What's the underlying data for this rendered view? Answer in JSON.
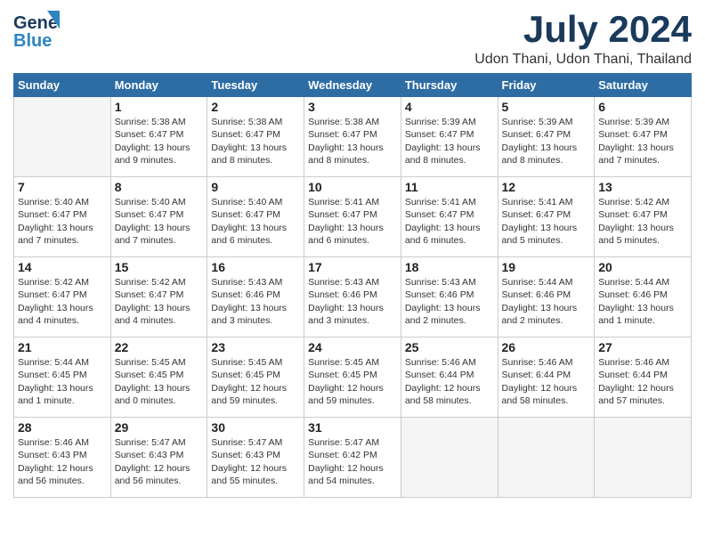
{
  "header": {
    "logo_line1": "General",
    "logo_line2": "Blue",
    "month_title": "July 2024",
    "location": "Udon Thani, Udon Thani, Thailand"
  },
  "days_of_week": [
    "Sunday",
    "Monday",
    "Tuesday",
    "Wednesday",
    "Thursday",
    "Friday",
    "Saturday"
  ],
  "weeks": [
    [
      {
        "day": "",
        "info": ""
      },
      {
        "day": "1",
        "info": "Sunrise: 5:38 AM\nSunset: 6:47 PM\nDaylight: 13 hours\nand 9 minutes."
      },
      {
        "day": "2",
        "info": "Sunrise: 5:38 AM\nSunset: 6:47 PM\nDaylight: 13 hours\nand 8 minutes."
      },
      {
        "day": "3",
        "info": "Sunrise: 5:38 AM\nSunset: 6:47 PM\nDaylight: 13 hours\nand 8 minutes."
      },
      {
        "day": "4",
        "info": "Sunrise: 5:39 AM\nSunset: 6:47 PM\nDaylight: 13 hours\nand 8 minutes."
      },
      {
        "day": "5",
        "info": "Sunrise: 5:39 AM\nSunset: 6:47 PM\nDaylight: 13 hours\nand 8 minutes."
      },
      {
        "day": "6",
        "info": "Sunrise: 5:39 AM\nSunset: 6:47 PM\nDaylight: 13 hours\nand 7 minutes."
      }
    ],
    [
      {
        "day": "7",
        "info": "Sunrise: 5:40 AM\nSunset: 6:47 PM\nDaylight: 13 hours\nand 7 minutes."
      },
      {
        "day": "8",
        "info": "Sunrise: 5:40 AM\nSunset: 6:47 PM\nDaylight: 13 hours\nand 7 minutes."
      },
      {
        "day": "9",
        "info": "Sunrise: 5:40 AM\nSunset: 6:47 PM\nDaylight: 13 hours\nand 6 minutes."
      },
      {
        "day": "10",
        "info": "Sunrise: 5:41 AM\nSunset: 6:47 PM\nDaylight: 13 hours\nand 6 minutes."
      },
      {
        "day": "11",
        "info": "Sunrise: 5:41 AM\nSunset: 6:47 PM\nDaylight: 13 hours\nand 6 minutes."
      },
      {
        "day": "12",
        "info": "Sunrise: 5:41 AM\nSunset: 6:47 PM\nDaylight: 13 hours\nand 5 minutes."
      },
      {
        "day": "13",
        "info": "Sunrise: 5:42 AM\nSunset: 6:47 PM\nDaylight: 13 hours\nand 5 minutes."
      }
    ],
    [
      {
        "day": "14",
        "info": "Sunrise: 5:42 AM\nSunset: 6:47 PM\nDaylight: 13 hours\nand 4 minutes."
      },
      {
        "day": "15",
        "info": "Sunrise: 5:42 AM\nSunset: 6:47 PM\nDaylight: 13 hours\nand 4 minutes."
      },
      {
        "day": "16",
        "info": "Sunrise: 5:43 AM\nSunset: 6:46 PM\nDaylight: 13 hours\nand 3 minutes."
      },
      {
        "day": "17",
        "info": "Sunrise: 5:43 AM\nSunset: 6:46 PM\nDaylight: 13 hours\nand 3 minutes."
      },
      {
        "day": "18",
        "info": "Sunrise: 5:43 AM\nSunset: 6:46 PM\nDaylight: 13 hours\nand 2 minutes."
      },
      {
        "day": "19",
        "info": "Sunrise: 5:44 AM\nSunset: 6:46 PM\nDaylight: 13 hours\nand 2 minutes."
      },
      {
        "day": "20",
        "info": "Sunrise: 5:44 AM\nSunset: 6:46 PM\nDaylight: 13 hours\nand 1 minute."
      }
    ],
    [
      {
        "day": "21",
        "info": "Sunrise: 5:44 AM\nSunset: 6:45 PM\nDaylight: 13 hours\nand 1 minute."
      },
      {
        "day": "22",
        "info": "Sunrise: 5:45 AM\nSunset: 6:45 PM\nDaylight: 13 hours\nand 0 minutes."
      },
      {
        "day": "23",
        "info": "Sunrise: 5:45 AM\nSunset: 6:45 PM\nDaylight: 12 hours\nand 59 minutes."
      },
      {
        "day": "24",
        "info": "Sunrise: 5:45 AM\nSunset: 6:45 PM\nDaylight: 12 hours\nand 59 minutes."
      },
      {
        "day": "25",
        "info": "Sunrise: 5:46 AM\nSunset: 6:44 PM\nDaylight: 12 hours\nand 58 minutes."
      },
      {
        "day": "26",
        "info": "Sunrise: 5:46 AM\nSunset: 6:44 PM\nDaylight: 12 hours\nand 58 minutes."
      },
      {
        "day": "27",
        "info": "Sunrise: 5:46 AM\nSunset: 6:44 PM\nDaylight: 12 hours\nand 57 minutes."
      }
    ],
    [
      {
        "day": "28",
        "info": "Sunrise: 5:46 AM\nSunset: 6:43 PM\nDaylight: 12 hours\nand 56 minutes."
      },
      {
        "day": "29",
        "info": "Sunrise: 5:47 AM\nSunset: 6:43 PM\nDaylight: 12 hours\nand 56 minutes."
      },
      {
        "day": "30",
        "info": "Sunrise: 5:47 AM\nSunset: 6:43 PM\nDaylight: 12 hours\nand 55 minutes."
      },
      {
        "day": "31",
        "info": "Sunrise: 5:47 AM\nSunset: 6:42 PM\nDaylight: 12 hours\nand 54 minutes."
      },
      {
        "day": "",
        "info": ""
      },
      {
        "day": "",
        "info": ""
      },
      {
        "day": "",
        "info": ""
      }
    ]
  ]
}
